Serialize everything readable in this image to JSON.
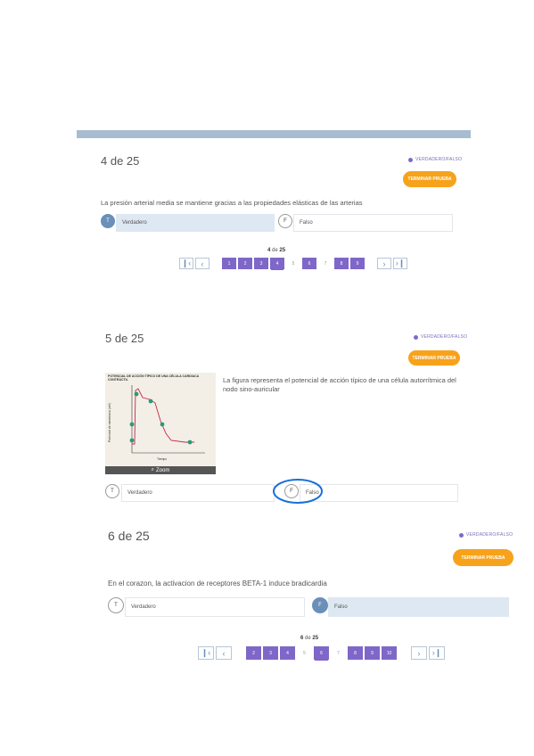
{
  "blocks": [
    {
      "title": "4 de 25",
      "tag": "VERDADERO/FALSO",
      "finish": "TERMINAR PRUEBA",
      "question": "La presión arterial media se mantiene gracias a las propiedades elásticas de las arterias",
      "options": [
        {
          "badge": "T",
          "label": "Verdadero",
          "selected": true
        },
        {
          "badge": "F",
          "label": "Falso",
          "selected": false
        }
      ],
      "pager": {
        "current": "4",
        "total": "25",
        "separator": "de",
        "pages": [
          "1",
          "2",
          "3",
          "4",
          "5",
          "6",
          "7",
          "8",
          "9"
        ]
      }
    },
    {
      "title": "5 de 25",
      "tag": "VERDADERO/FALSO",
      "finish": "TERMINAR PRUEBA",
      "question": "La figura representa el potencial de acción típico de una célula autorrítmica del nodo sino-auricular",
      "figure": {
        "caption": "POTENCIAL DE ACCIÓN TÍPICO DE UNA CÉLULA CARDIACA CONTRÁCTIL",
        "zoom": "Zoom",
        "ylabel": "Potencial de membrana (mV)",
        "xlabel": "Tiempo"
      },
      "options": [
        {
          "badge": "T",
          "label": "Verdadero",
          "selected": false
        },
        {
          "badge": "F",
          "label": "Falso",
          "selected": false
        }
      ]
    },
    {
      "title": "6 de 25",
      "tag": "VERDADERO/FALSO",
      "finish": "TERMINAR PRUEBA",
      "question": "En el corazon, la activacion de receptores BETA-1 induce bradicardia",
      "options": [
        {
          "badge": "T",
          "label": "Verdadero",
          "selected": false
        },
        {
          "badge": "F",
          "label": "Falso",
          "selected": true
        }
      ],
      "pager": {
        "current": "6",
        "total": "25",
        "separator": "de",
        "pages": [
          "2",
          "3",
          "4",
          "5",
          "6",
          "7",
          "8",
          "9",
          "10"
        ]
      }
    }
  ],
  "icons": {
    "first": "first-page-icon",
    "prev": "prev-page-icon",
    "next": "next-page-icon",
    "last": "last-page-icon",
    "zoom": "magnifier-icon"
  },
  "colors": {
    "accent": "#7e67c8",
    "finish": "#f7a21b",
    "selected": "#dde8f2",
    "topbar": "#a8bcd1",
    "annotation": "#1a6fd6"
  }
}
